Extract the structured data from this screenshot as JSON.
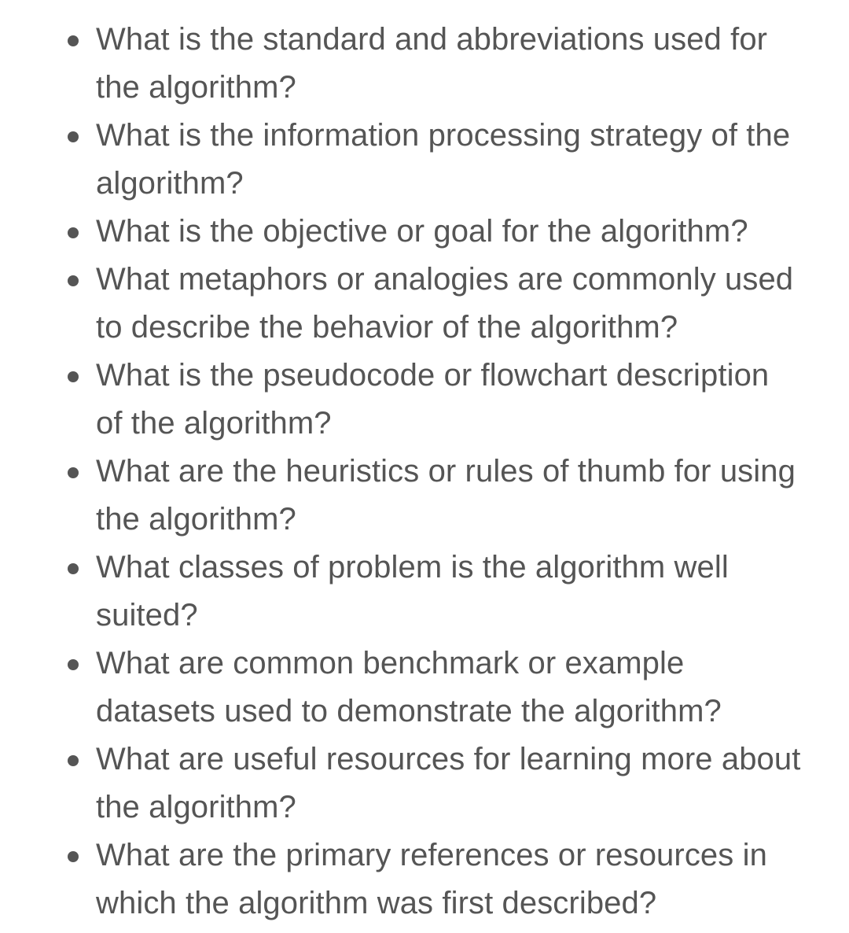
{
  "questions": [
    {
      "lines": [
        "What is the standard and abbreviations used for",
        "the algorithm?"
      ]
    },
    {
      "lines": [
        "What is the information processing strategy of the",
        "algorithm?"
      ]
    },
    {
      "lines": [
        "What is the objective or goal for the algorithm?"
      ]
    },
    {
      "lines": [
        "What metaphors or analogies are commonly used",
        "to describe the behavior of the algorithm?"
      ]
    },
    {
      "lines": [
        "What is the pseudocode or flowchart description",
        "of the algorithm?"
      ]
    },
    {
      "lines": [
        "What are the heuristics or rules of thumb for using",
        "the algorithm?"
      ]
    },
    {
      "lines": [
        "What classes of problem is the algorithm well",
        "suited?"
      ]
    },
    {
      "lines": [
        "What are common benchmark or example",
        "datasets used to demonstrate the algorithm?"
      ]
    },
    {
      "lines": [
        "What are useful resources for learning more about",
        "the algorithm?"
      ]
    },
    {
      "lines": [
        "What are the primary references or resources in",
        "which the algorithm was first described?"
      ]
    }
  ],
  "colors": {
    "text": "#555555",
    "background": "#ffffff"
  }
}
